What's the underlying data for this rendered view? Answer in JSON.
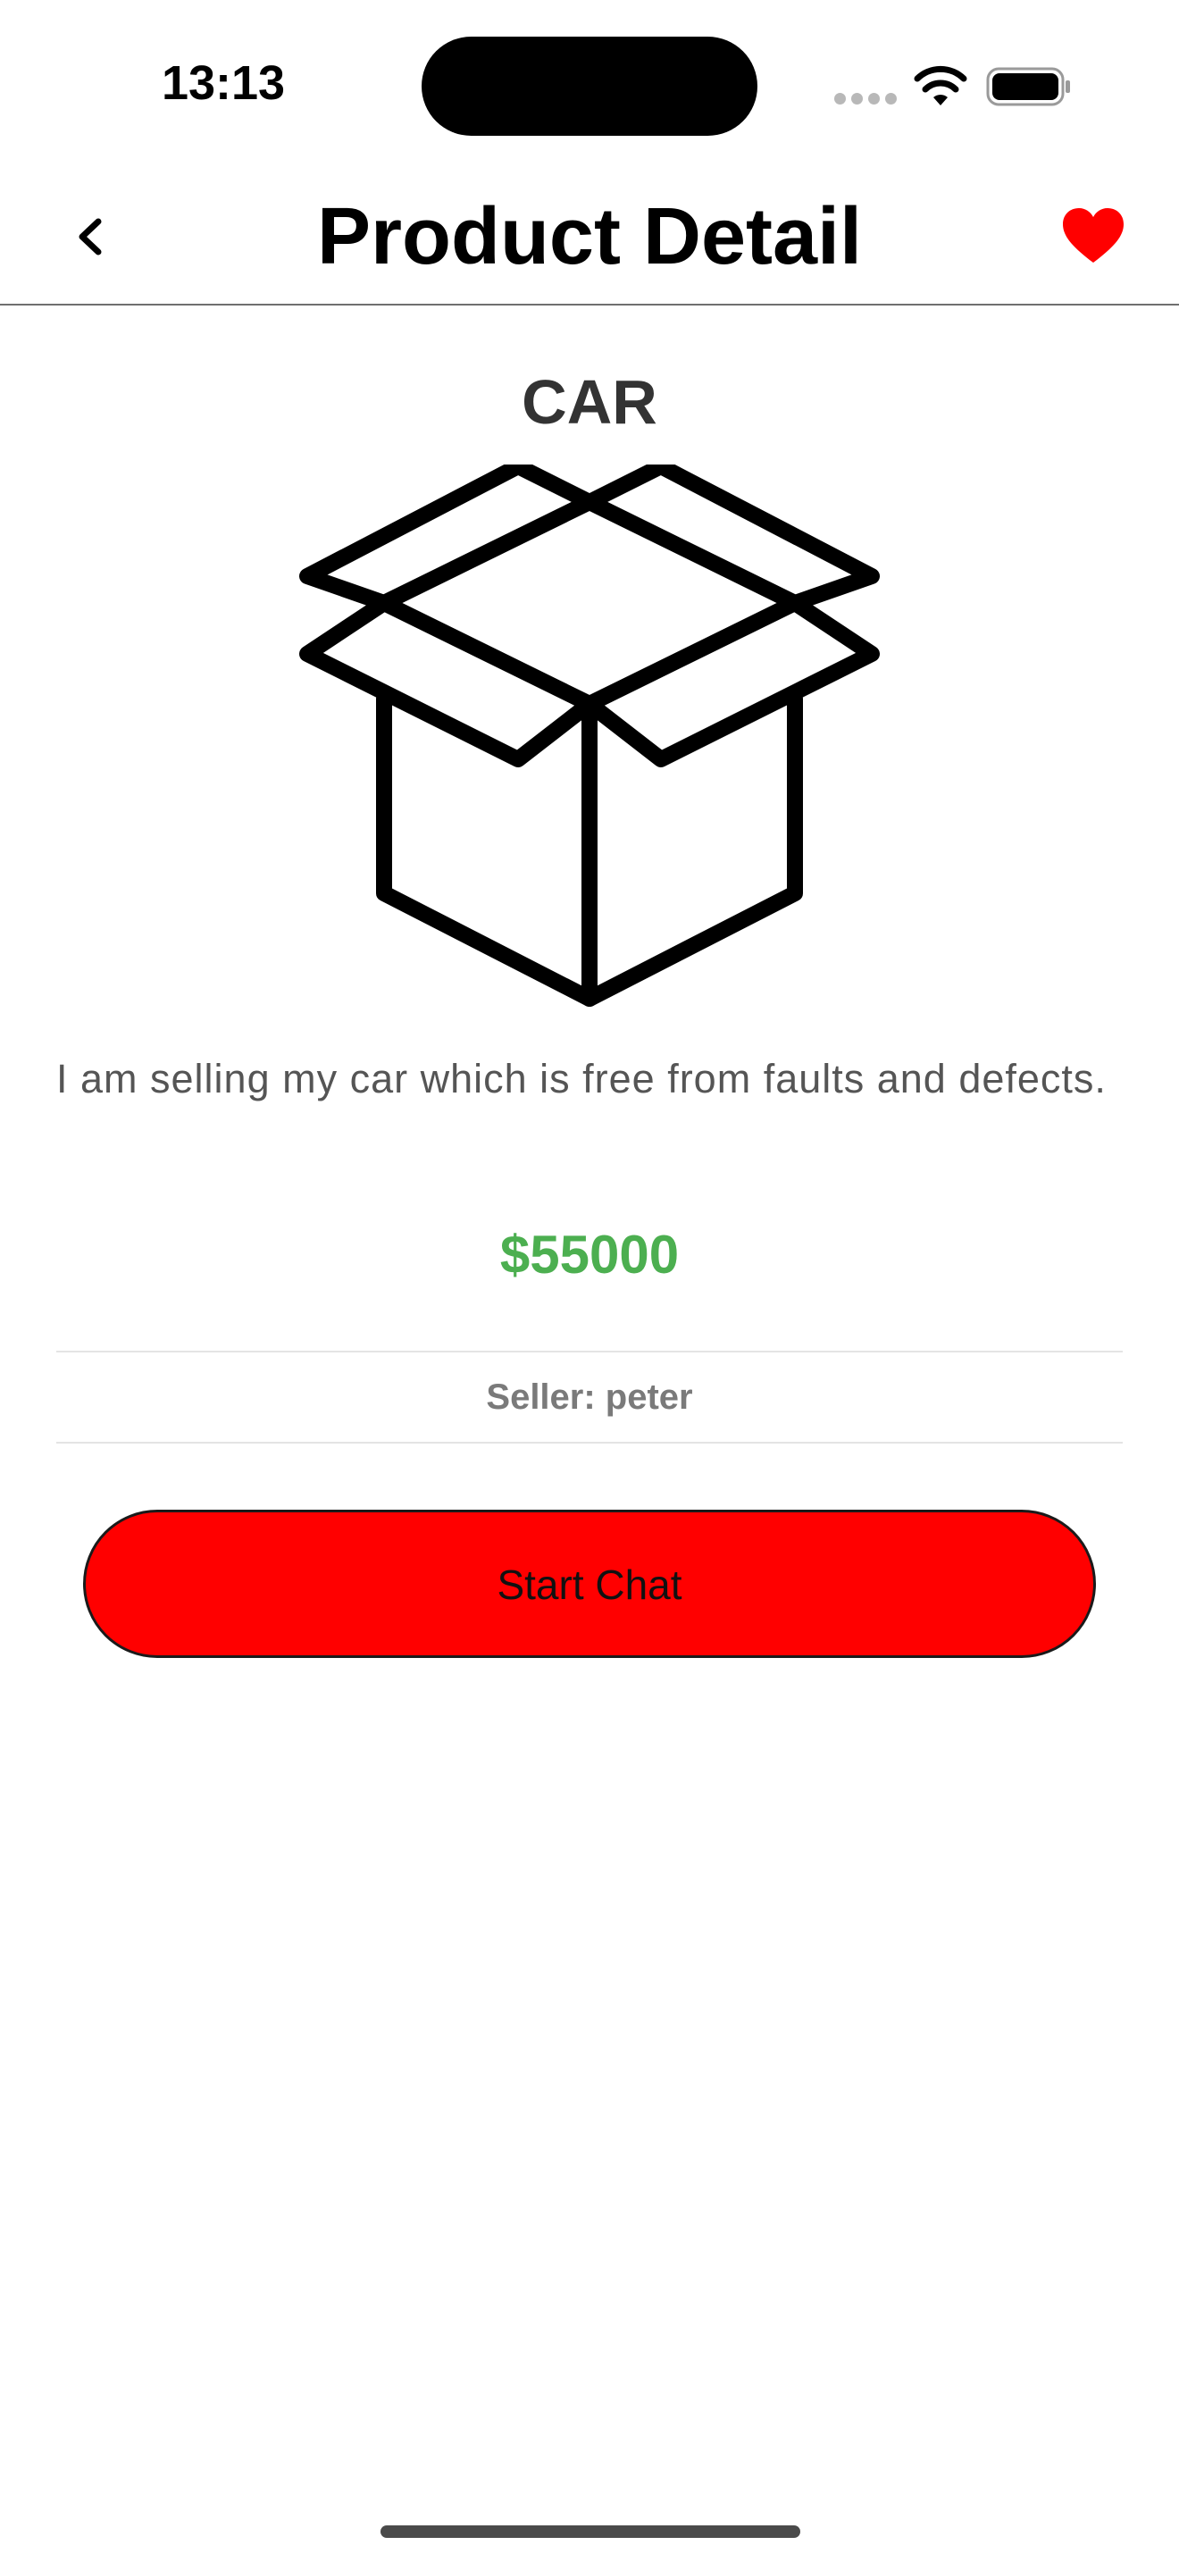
{
  "status_bar": {
    "time": "13:13"
  },
  "nav": {
    "title": "Product Detail",
    "back_icon": "chevron-left-icon",
    "favorite_icon": "heart-icon",
    "favorite_color": "#ff0000"
  },
  "product": {
    "name": "CAR",
    "image_icon": "open-box-icon",
    "description": "I am selling my car which is free from faults and defects.",
    "price": "$55000",
    "price_color": "#4caf50",
    "seller": "Seller: peter"
  },
  "actions": {
    "start_chat_label": "Start Chat",
    "start_chat_color": "#ff0000"
  }
}
